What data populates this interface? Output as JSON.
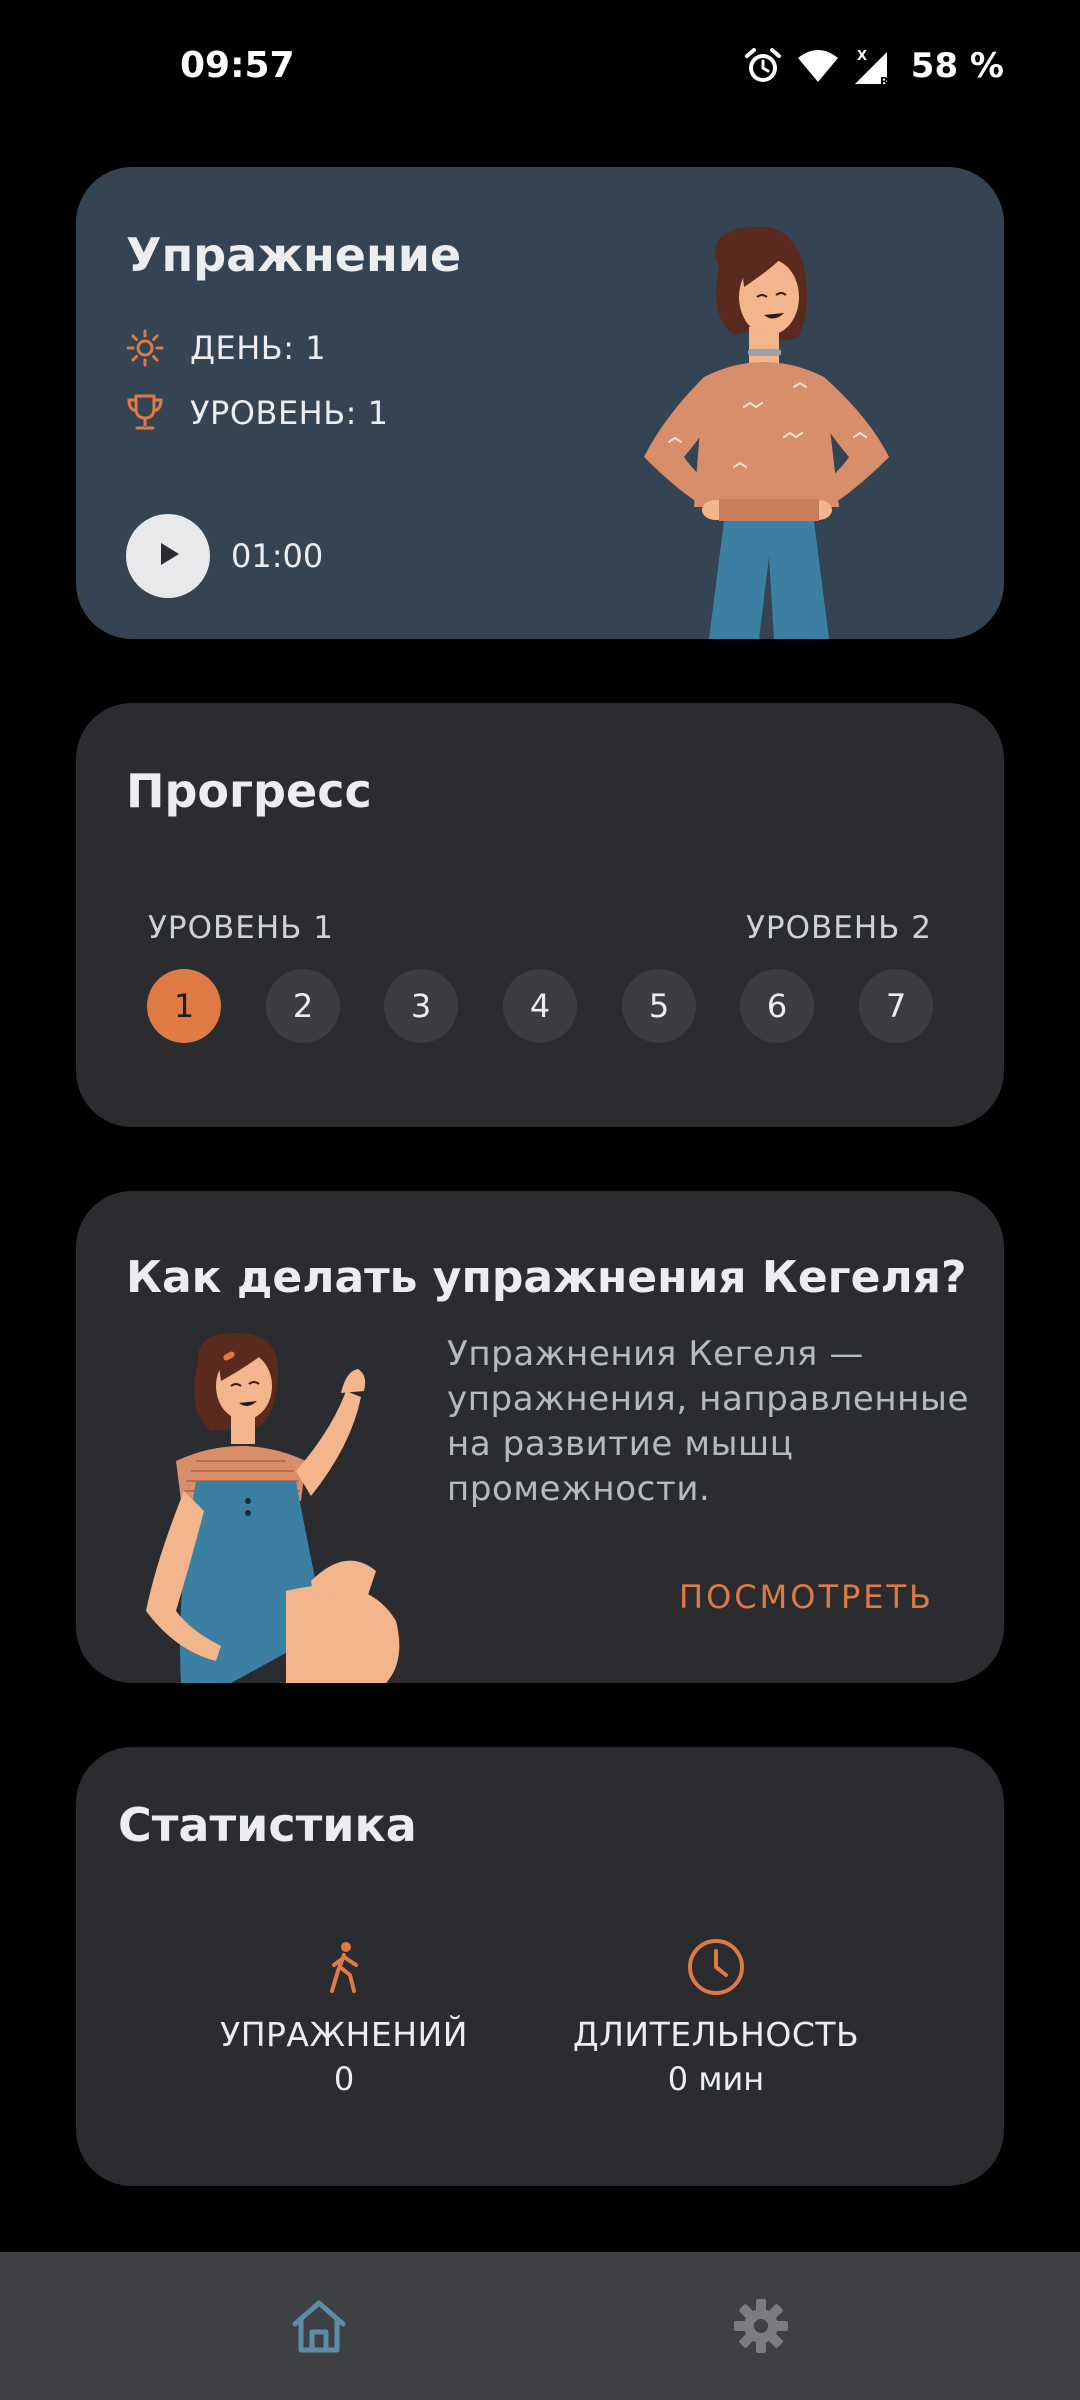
{
  "status_bar": {
    "time": "09:57",
    "battery": "58 %",
    "icons": [
      "alarm-icon",
      "wifi-icon",
      "signal-icon"
    ]
  },
  "exercise_card": {
    "title": "Упражнение",
    "day_label": "ДЕНЬ: 1",
    "level_label": "УРОВЕНЬ: 1",
    "duration": "01:00",
    "icons": [
      "sun-icon",
      "trophy-icon",
      "play-icon"
    ]
  },
  "progress_card": {
    "title": "Прогресс",
    "level_start": "УРОВЕНЬ 1",
    "level_end": "УРОВЕНЬ 2",
    "days": [
      "1",
      "2",
      "3",
      "4",
      "5",
      "6",
      "7"
    ],
    "current_day": 1
  },
  "kegel_card": {
    "title": "Как делать упражнения Кегеля?",
    "description": "Упражнения Кегеля — упражнения, направленные на развитие мышц промежности.",
    "link": "ПОСМОТРЕТЬ"
  },
  "stats_card": {
    "title": "Статистика",
    "exercises_label": "УПРАЖНЕНИЙ",
    "exercises_value": "0",
    "duration_label": "ДЛИТЕЛЬНОСТЬ",
    "duration_value": "0 мин",
    "icons": [
      "walking-icon",
      "clock-icon"
    ]
  },
  "colors": {
    "accent": "#E07A45",
    "card_primary": "#344452",
    "card": "#2A2C30",
    "nav_bar": "#3F4043",
    "nav_active": "#5B8EA6",
    "nav_inactive": "#7A7C80"
  },
  "bottom_nav": {
    "items": [
      "home-icon",
      "gear-icon"
    ],
    "active": "home-icon"
  }
}
